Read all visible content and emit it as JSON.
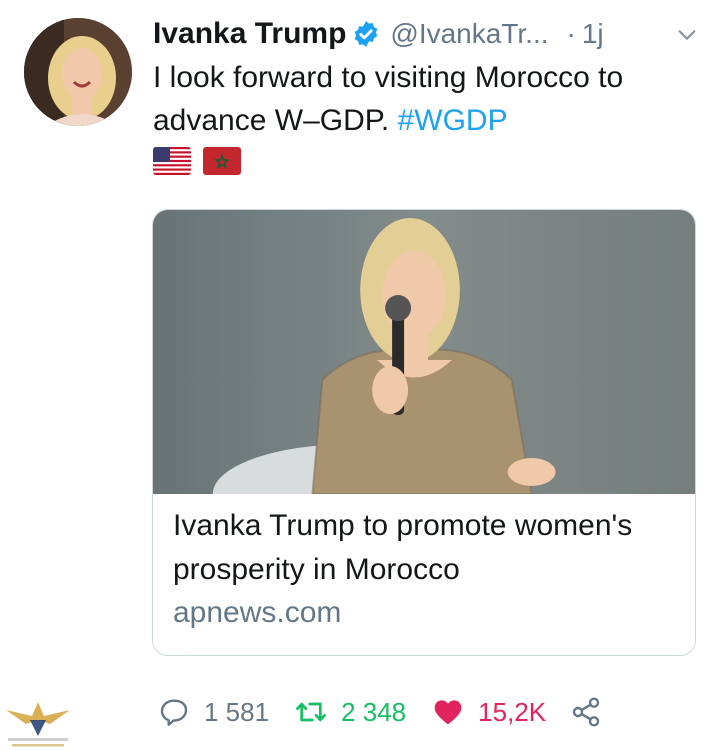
{
  "tweet": {
    "author_name": "Ivanka Trump",
    "author_handle": "@IvankaTr...",
    "separator": "·",
    "time": "1j",
    "text": "I look forward to visiting Morocco to advance W–GDP.",
    "hashtag": "#WGDP",
    "flags": [
      "us-flag-icon",
      "morocco-flag-icon"
    ]
  },
  "card": {
    "title": "Ivanka Trump to promote women's prosperity in Morocco",
    "domain": "apnews.com"
  },
  "actions": {
    "replies": "1 581",
    "retweets": "2 348",
    "likes": "15,2K"
  },
  "colors": {
    "link": "#1da1f2",
    "retweet": "#17bf63",
    "like": "#e0245e",
    "muted": "#657786"
  }
}
